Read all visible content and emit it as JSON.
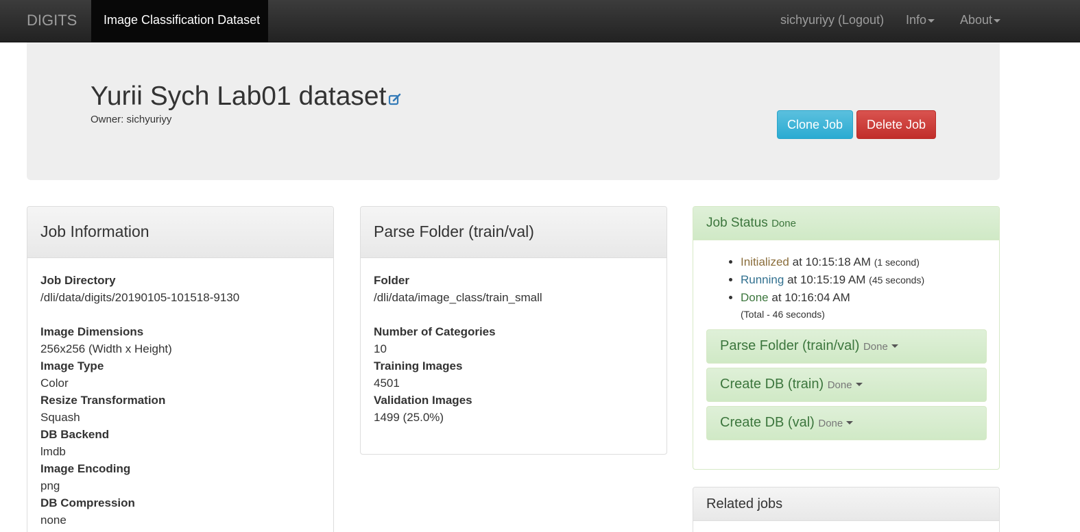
{
  "navbar": {
    "brand": "DIGITS",
    "active_tab": "Image Classification Dataset",
    "user_link": "sichyuriyy (Logout)",
    "info_menu": "Info",
    "about_menu": "About"
  },
  "header": {
    "title": "Yurii Sych Lab01 dataset",
    "owner": "Owner: sichyuriyy",
    "clone_label": "Clone Job",
    "delete_label": "Delete Job"
  },
  "job_info": {
    "heading": "Job Information",
    "fields": [
      {
        "label": "Job Directory",
        "value": "/dli/data/digits/20190105-101518-9130"
      },
      {
        "label": "Image Dimensions",
        "value": "256x256 (Width x Height)"
      },
      {
        "label": "Image Type",
        "value": "Color"
      },
      {
        "label": "Resize Transformation",
        "value": "Squash"
      },
      {
        "label": "DB Backend",
        "value": "lmdb"
      },
      {
        "label": "Image Encoding",
        "value": "png"
      },
      {
        "label": "DB Compression",
        "value": "none"
      }
    ]
  },
  "parse_folder": {
    "heading": "Parse Folder (train/val)",
    "fields": [
      {
        "label": "Folder",
        "value": "/dli/data/image_class/train_small"
      },
      {
        "label": "Number of Categories",
        "value": "10"
      },
      {
        "label": "Training Images",
        "value": "4501"
      },
      {
        "label": "Validation Images",
        "value": "1499 (25.0%)"
      }
    ]
  },
  "job_status": {
    "heading": "Job Status",
    "state": "Done",
    "timeline": [
      {
        "status": "Initialized",
        "time": "at 10:15:18 AM",
        "duration": "(1 second)"
      },
      {
        "status": "Running",
        "time": "at 10:15:19 AM",
        "duration": "(45 seconds)"
      },
      {
        "status": "Done",
        "time": "at 10:16:04 AM",
        "duration": ""
      }
    ],
    "total": "(Total - 46 seconds)",
    "tasks": [
      {
        "name": "Parse Folder (train/val)",
        "state": "Done"
      },
      {
        "name": "Create DB (train)",
        "state": "Done"
      },
      {
        "name": "Create DB (val)",
        "state": "Done"
      }
    ]
  },
  "related": {
    "heading": "Related jobs"
  }
}
